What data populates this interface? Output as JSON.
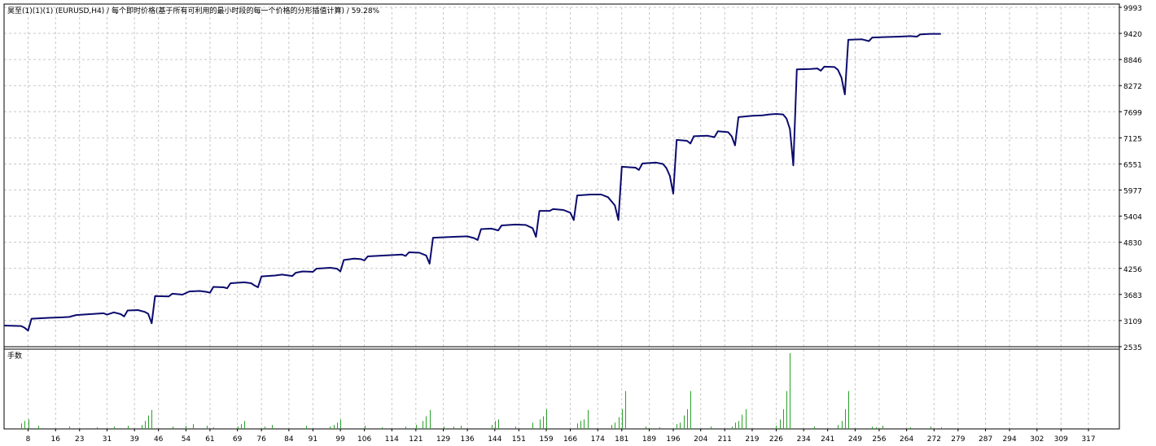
{
  "header_text": "昊至(1)(1)(1) (EURUSD,H4) / 每个即时价格(基于所有可利用的最小时段的每一个价格的分形插值计算) / 59.28%",
  "lot_panel_label": "手数",
  "colors": {
    "balance_line": "#0b0b6e",
    "volume_bars": "#2aa02a",
    "grid": "#c8c8c8",
    "frame": "#000000"
  },
  "chart_data": [
    {
      "type": "line",
      "name": "balance",
      "ylim": [
        2535,
        9993
      ],
      "y_ticks": [
        2535,
        3109,
        3683,
        4256,
        4830,
        5404,
        5977,
        6551,
        7125,
        7699,
        8272,
        8846,
        9420,
        9993
      ],
      "x_ticks": [
        8,
        16,
        23,
        31,
        39,
        46,
        54,
        61,
        69,
        76,
        84,
        91,
        99,
        106,
        114,
        121,
        129,
        136,
        144,
        151,
        159,
        166,
        174,
        181,
        189,
        196,
        204,
        211,
        219,
        226,
        234,
        241,
        249,
        256,
        264,
        272,
        279,
        287,
        294,
        302,
        309,
        317
      ],
      "xlim": [
        1,
        326
      ],
      "grid": true,
      "points": [
        [
          1,
          3000
        ],
        [
          6,
          2990
        ],
        [
          7,
          2950
        ],
        [
          8,
          2890
        ],
        [
          9,
          3150
        ],
        [
          14,
          3170
        ],
        [
          18,
          3180
        ],
        [
          20,
          3190
        ],
        [
          22,
          3230
        ],
        [
          26,
          3250
        ],
        [
          30,
          3270
        ],
        [
          31,
          3240
        ],
        [
          33,
          3290
        ],
        [
          35,
          3250
        ],
        [
          36,
          3200
        ],
        [
          37,
          3330
        ],
        [
          40,
          3340
        ],
        [
          42,
          3300
        ],
        [
          43,
          3260
        ],
        [
          44,
          3050
        ],
        [
          45,
          3650
        ],
        [
          49,
          3640
        ],
        [
          50,
          3700
        ],
        [
          53,
          3680
        ],
        [
          55,
          3750
        ],
        [
          58,
          3760
        ],
        [
          60,
          3740
        ],
        [
          61,
          3720
        ],
        [
          62,
          3850
        ],
        [
          65,
          3840
        ],
        [
          66,
          3820
        ],
        [
          67,
          3930
        ],
        [
          71,
          3950
        ],
        [
          73,
          3930
        ],
        [
          74,
          3880
        ],
        [
          75,
          3840
        ],
        [
          76,
          4080
        ],
        [
          80,
          4100
        ],
        [
          82,
          4120
        ],
        [
          85,
          4090
        ],
        [
          86,
          4160
        ],
        [
          88,
          4190
        ],
        [
          91,
          4180
        ],
        [
          92,
          4250
        ],
        [
          96,
          4270
        ],
        [
          98,
          4250
        ],
        [
          99,
          4190
        ],
        [
          100,
          4440
        ],
        [
          103,
          4470
        ],
        [
          105,
          4460
        ],
        [
          106,
          4430
        ],
        [
          107,
          4520
        ],
        [
          112,
          4540
        ],
        [
          117,
          4560
        ],
        [
          118,
          4530
        ],
        [
          119,
          4610
        ],
        [
          122,
          4600
        ],
        [
          124,
          4540
        ],
        [
          125,
          4360
        ],
        [
          126,
          4930
        ],
        [
          132,
          4950
        ],
        [
          136,
          4960
        ],
        [
          138,
          4920
        ],
        [
          139,
          4880
        ],
        [
          140,
          5120
        ],
        [
          143,
          5130
        ],
        [
          145,
          5090
        ],
        [
          146,
          5200
        ],
        [
          150,
          5220
        ],
        [
          153,
          5210
        ],
        [
          155,
          5140
        ],
        [
          156,
          4950
        ],
        [
          157,
          5520
        ],
        [
          160,
          5520
        ],
        [
          161,
          5560
        ],
        [
          164,
          5540
        ],
        [
          166,
          5480
        ],
        [
          167,
          5320
        ],
        [
          168,
          5860
        ],
        [
          172,
          5880
        ],
        [
          175,
          5880
        ],
        [
          177,
          5820
        ],
        [
          179,
          5640
        ],
        [
          180,
          5320
        ],
        [
          181,
          6490
        ],
        [
          185,
          6470
        ],
        [
          186,
          6420
        ],
        [
          187,
          6560
        ],
        [
          191,
          6580
        ],
        [
          193,
          6550
        ],
        [
          194,
          6460
        ],
        [
          195,
          6290
        ],
        [
          196,
          5900
        ],
        [
          197,
          7080
        ],
        [
          200,
          7060
        ],
        [
          201,
          7000
        ],
        [
          202,
          7160
        ],
        [
          206,
          7170
        ],
        [
          208,
          7140
        ],
        [
          209,
          7270
        ],
        [
          212,
          7250
        ],
        [
          213,
          7160
        ],
        [
          214,
          6960
        ],
        [
          215,
          7580
        ],
        [
          219,
          7610
        ],
        [
          222,
          7620
        ],
        [
          224,
          7640
        ],
        [
          226,
          7650
        ],
        [
          228,
          7640
        ],
        [
          229,
          7550
        ],
        [
          230,
          7320
        ],
        [
          231,
          6520
        ],
        [
          232,
          8630
        ],
        [
          236,
          8640
        ],
        [
          238,
          8650
        ],
        [
          239,
          8600
        ],
        [
          240,
          8690
        ],
        [
          243,
          8680
        ],
        [
          244,
          8620
        ],
        [
          245,
          8450
        ],
        [
          246,
          8080
        ],
        [
          247,
          9280
        ],
        [
          251,
          9290
        ],
        [
          253,
          9250
        ],
        [
          254,
          9330
        ],
        [
          258,
          9340
        ],
        [
          262,
          9350
        ],
        [
          265,
          9360
        ],
        [
          267,
          9350
        ],
        [
          268,
          9400
        ],
        [
          271,
          9410
        ],
        [
          274,
          9410
        ]
      ]
    },
    {
      "type": "bar",
      "name": "lots",
      "ylim": [
        0,
        1
      ],
      "bars": [
        [
          6,
          0.07
        ],
        [
          7,
          0.1
        ],
        [
          8,
          0.12
        ],
        [
          11,
          0.04
        ],
        [
          20,
          0.03
        ],
        [
          28,
          0.02
        ],
        [
          33,
          0.03
        ],
        [
          37,
          0.04
        ],
        [
          41,
          0.05
        ],
        [
          42,
          0.1
        ],
        [
          43,
          0.17
        ],
        [
          44,
          0.24
        ],
        [
          50,
          0.03
        ],
        [
          54,
          0.04
        ],
        [
          56,
          0.06
        ],
        [
          60,
          0.04
        ],
        [
          62,
          0.02
        ],
        [
          69,
          0.03
        ],
        [
          70,
          0.06
        ],
        [
          71,
          0.1
        ],
        [
          77,
          0.03
        ],
        [
          79,
          0.05
        ],
        [
          89,
          0.04
        ],
        [
          96,
          0.03
        ],
        [
          97,
          0.05
        ],
        [
          98,
          0.08
        ],
        [
          99,
          0.12
        ],
        [
          106,
          0.04
        ],
        [
          111,
          0.02
        ],
        [
          118,
          0.03
        ],
        [
          121,
          0.05
        ],
        [
          123,
          0.1
        ],
        [
          124,
          0.16
        ],
        [
          125,
          0.24
        ],
        [
          129,
          0.03
        ],
        [
          132,
          0.03
        ],
        [
          134,
          0.04
        ],
        [
          143,
          0.05
        ],
        [
          144,
          0.1
        ],
        [
          145,
          0.12
        ],
        [
          150,
          0.03
        ],
        [
          155,
          0.08
        ],
        [
          157,
          0.12
        ],
        [
          158,
          0.16
        ],
        [
          159,
          0.25
        ],
        [
          168,
          0.07
        ],
        [
          169,
          0.1
        ],
        [
          170,
          0.12
        ],
        [
          171,
          0.24
        ],
        [
          178,
          0.05
        ],
        [
          179,
          0.08
        ],
        [
          180,
          0.15
        ],
        [
          181,
          0.25
        ],
        [
          182,
          0.48
        ],
        [
          188,
          0.03
        ],
        [
          192,
          0.02
        ],
        [
          197,
          0.06
        ],
        [
          198,
          0.08
        ],
        [
          199,
          0.17
        ],
        [
          200,
          0.25
        ],
        [
          201,
          0.48
        ],
        [
          207,
          0.03
        ],
        [
          213,
          0.03
        ],
        [
          214,
          0.08
        ],
        [
          215,
          0.1
        ],
        [
          216,
          0.18
        ],
        [
          217,
          0.25
        ],
        [
          226,
          0.04
        ],
        [
          227,
          0.12
        ],
        [
          228,
          0.25
        ],
        [
          229,
          0.48
        ],
        [
          230,
          0.96
        ],
        [
          237,
          0.03
        ],
        [
          244,
          0.05
        ],
        [
          245,
          0.1
        ],
        [
          246,
          0.25
        ],
        [
          247,
          0.48
        ],
        [
          254,
          0.03
        ],
        [
          255,
          0.02
        ],
        [
          257,
          0.04
        ],
        [
          265,
          0.02
        ],
        [
          271,
          0.03
        ],
        [
          274,
          0.02
        ]
      ]
    }
  ]
}
